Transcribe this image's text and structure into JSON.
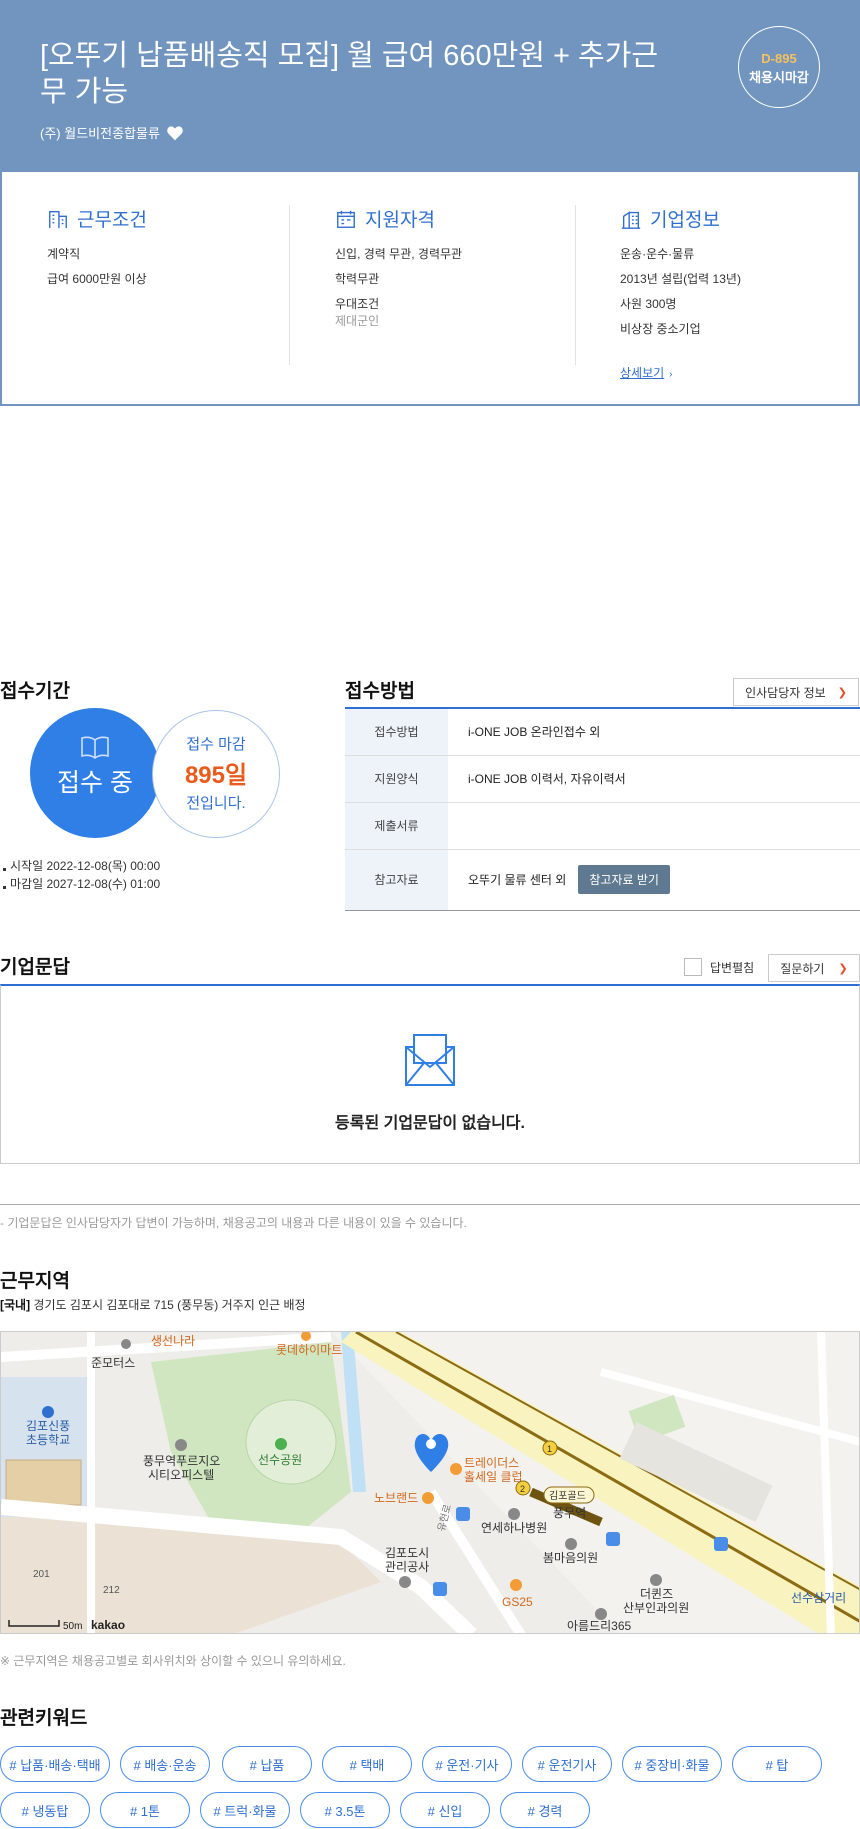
{
  "header": {
    "title": "[오뚜기 납품배송직 모집] 월 급여 660만원 + 추가근무 가능",
    "company": "(주) 월드비전종합물류",
    "dday": "D-895",
    "dday_label": "채용시마감"
  },
  "info": {
    "conditions": {
      "title": "근무조건",
      "lines": [
        "계약직",
        "급여 6000만원 이상"
      ]
    },
    "qualifications": {
      "title": "지원자격",
      "lines": [
        "신입, 경력 무관, 경력무관",
        "학력무관",
        "우대조건"
      ],
      "sub": "제대군인"
    },
    "company": {
      "title": "기업정보",
      "lines": [
        "운송·운수·물류",
        "2013년 설립(업력 13년)",
        "사원 300명",
        "비상장 중소기업"
      ],
      "link": "상세보기"
    }
  },
  "period": {
    "title": "접수기간",
    "status": "접수 중",
    "deadline_label": "접수 마감",
    "days": "895일",
    "days_suffix": "전입니다.",
    "start": "시작일 2022-12-08(목) 00:00",
    "end": "마감일 2027-12-08(수) 01:00"
  },
  "method": {
    "title": "접수방법",
    "hr_button": "인사담당자 정보",
    "rows": [
      {
        "key": "접수방법",
        "value": "i-ONE JOB 온라인접수 외"
      },
      {
        "key": "지원양식",
        "value": "i-ONE JOB 이력서, 자유이력서"
      },
      {
        "key": "제출서류",
        "value": ""
      },
      {
        "key": "참고자료",
        "value": "오뚜기 물류 센터 외"
      }
    ],
    "ref_button": "참고자료 받기"
  },
  "qa": {
    "title": "기업문답",
    "toggle_label": "답변펼침",
    "ask_button": "질문하기",
    "empty": "등록된 기업문답이 없습니다.",
    "note": "- 기업문답은 인사담당자가 답변이 가능하며, 채용공고의 내용과 다른 내용이 있을 수 있습니다."
  },
  "location": {
    "title": "근무지역",
    "region_tag": "[국내]",
    "address": "경기도 김포시 김포대로 715 (풍무동) 거주지 인근 배정",
    "note": "※ 근무지역은 채용공고별로 회사위치와 상이할 수 있으니 유의하세요.",
    "map": {
      "labels": {
        "l1": "생선나라",
        "l2": "롯데하이마트",
        "l3": "준모터스",
        "l4": "김포신풍",
        "l5": "초등학교",
        "l6": "풍무역푸르지오",
        "l7": "시티오피스텔",
        "l8": "선수공원",
        "l9": "트레이더스",
        "l10": "홀세일 클럽",
        "l11": "노브랜드",
        "l12": "김포골드",
        "l13": "풍무역",
        "l14": "연세하나병원",
        "l15": "봄마음의원",
        "l16": "김포도시",
        "l17": "관리공사",
        "l18": "GS25",
        "l19": "더퀸즈",
        "l20": "산부인과의원",
        "l21": "아름드리365",
        "l22": "선수삼거리",
        "l23": "201",
        "l24": "212",
        "l25": "유현로"
      },
      "scale": "50m",
      "brand": "kakao"
    }
  },
  "keywords": {
    "title": "관련키워드",
    "items": [
      "# 납품·배송·택배",
      "# 배송·운송",
      "# 납품",
      "# 택배",
      "# 운전·기사",
      "# 운전기사",
      "# 중장비·화물",
      "# 탑",
      "# 냉동탑",
      "# 1톤",
      "# 트럭·화물",
      "# 3.5톤",
      "# 신입",
      "# 경력"
    ]
  },
  "colors": {
    "hero": "#7195bf",
    "accent": "#2f6fd0",
    "dday": "#f6c15e",
    "days": "#ea5a1a"
  }
}
